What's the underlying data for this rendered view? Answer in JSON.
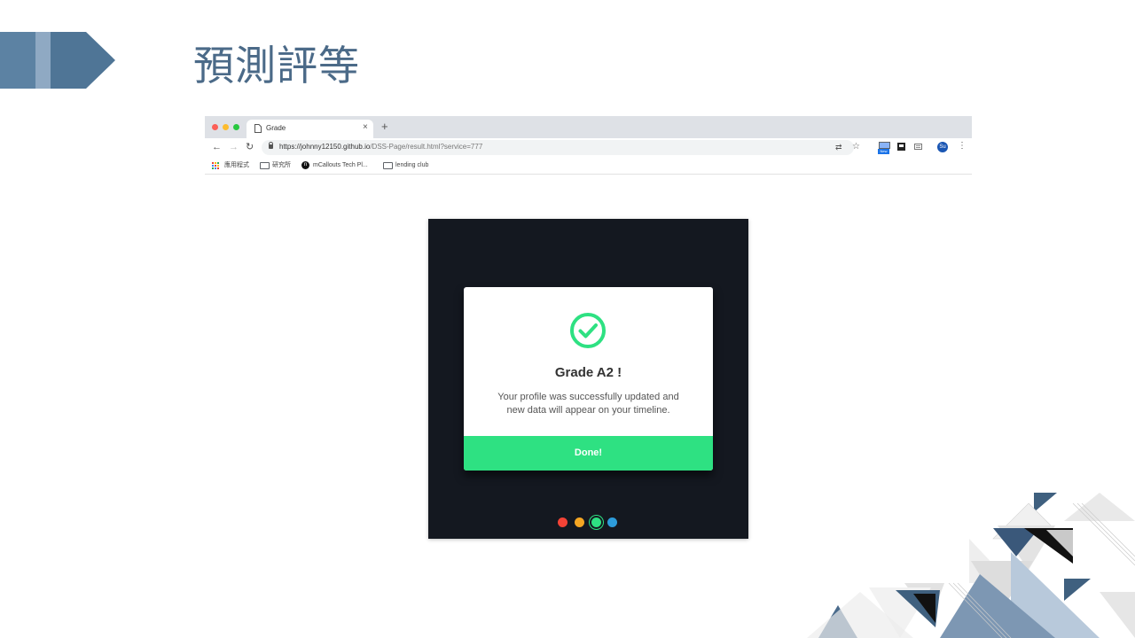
{
  "slide": {
    "title": "預測評等"
  },
  "browser": {
    "tab_title": "Grade",
    "tab_close": "×",
    "new_tab": "+",
    "url_host": "https://johnny12150.github.io",
    "url_path": "/DSS-Page/result.html?service=777",
    "extension_new_label": "New",
    "avatar_initials": "Su",
    "bookmarks": [
      {
        "label": "應用程式",
        "icon": "apps-icon"
      },
      {
        "label": "研究所",
        "icon": "folder-icon"
      },
      {
        "label": "mCallouts Tech Pl...",
        "icon": "mcallouts-icon"
      },
      {
        "label": "lending club",
        "icon": "folder-icon"
      }
    ]
  },
  "modal": {
    "title": "Grade A2 !",
    "message": "Your profile was successfully updated and new data will appear on your timeline.",
    "button_label": "Done!",
    "accent_color": "#2ee182"
  },
  "app": {
    "background": "#141820",
    "dots": [
      {
        "color": "#f44336",
        "active": false
      },
      {
        "color": "#f5a623",
        "active": false
      },
      {
        "color": "#2ee182",
        "active": true
      },
      {
        "color": "#2d9cdb",
        "active": false
      }
    ]
  }
}
